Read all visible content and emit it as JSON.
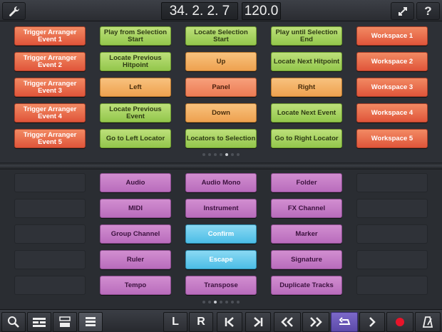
{
  "topbar": {
    "position": "34. 2. 2. 7",
    "tempo": "120.0",
    "icons": [
      "wrench-icon",
      "expand-icon",
      "help-icon"
    ],
    "help_label": "?"
  },
  "top_grid": {
    "columns": [
      {
        "pads": [
          {
            "label": "Trigger Arranger Event 1",
            "color": "orange"
          },
          {
            "label": "Trigger Arranger Event 2",
            "color": "orange"
          },
          {
            "label": "Trigger Arranger Event 3",
            "color": "orange"
          },
          {
            "label": "Trigger Arranger Event 4",
            "color": "orange"
          },
          {
            "label": "Trigger Arranger Event 5",
            "color": "orange"
          }
        ]
      },
      {
        "pads": [
          {
            "label": "Play from Selection Start",
            "color": "green"
          },
          {
            "label": "Locate Previous Hitpoint",
            "color": "green"
          },
          {
            "label": "Left",
            "color": "amber"
          },
          {
            "label": "Locate Previous Event",
            "color": "green"
          },
          {
            "label": "Go to Left Locator",
            "color": "green"
          }
        ]
      },
      {
        "pads": [
          {
            "label": "Locate Selection Start",
            "color": "green"
          },
          {
            "label": "Up",
            "color": "amber"
          },
          {
            "label": "Panel",
            "color": "salmon"
          },
          {
            "label": "Down",
            "color": "amber"
          },
          {
            "label": "Locators to Selection",
            "color": "green"
          }
        ]
      },
      {
        "pads": [
          {
            "label": "Play until Selection End",
            "color": "green"
          },
          {
            "label": "Locate Next Hitpoint",
            "color": "green"
          },
          {
            "label": "Right",
            "color": "amber"
          },
          {
            "label": "Locate Next Event",
            "color": "green"
          },
          {
            "label": "Go to Right Locator",
            "color": "green"
          }
        ]
      },
      {
        "pads": [
          {
            "label": "Workspace 1",
            "color": "orange"
          },
          {
            "label": "Workspace 2",
            "color": "orange"
          },
          {
            "label": "Workspace 3",
            "color": "orange"
          },
          {
            "label": "Workspace 4",
            "color": "orange"
          },
          {
            "label": "Workspace 5",
            "color": "orange"
          }
        ]
      }
    ],
    "page_count": 7,
    "active_page": 4
  },
  "bottom_grid": {
    "columns": [
      {
        "pads": [
          {
            "label": "",
            "color": "empty"
          },
          {
            "label": "",
            "color": "empty"
          },
          {
            "label": "",
            "color": "empty"
          },
          {
            "label": "",
            "color": "empty"
          },
          {
            "label": "",
            "color": "empty"
          }
        ]
      },
      {
        "pads": [
          {
            "label": "Audio",
            "color": "purple"
          },
          {
            "label": "MIDI",
            "color": "purple"
          },
          {
            "label": "Group Channel",
            "color": "purple"
          },
          {
            "label": "Ruler",
            "color": "purple"
          },
          {
            "label": "Tempo",
            "color": "purple"
          }
        ]
      },
      {
        "pads": [
          {
            "label": "Audio Mono",
            "color": "purple"
          },
          {
            "label": "Instrument",
            "color": "purple"
          },
          {
            "label": "Confirm",
            "color": "blue"
          },
          {
            "label": "Escape",
            "color": "blue"
          },
          {
            "label": "Transpose",
            "color": "purple"
          }
        ]
      },
      {
        "pads": [
          {
            "label": "Folder",
            "color": "purple"
          },
          {
            "label": "FX Channel",
            "color": "purple"
          },
          {
            "label": "Marker",
            "color": "purple"
          },
          {
            "label": "Signature",
            "color": "purple"
          },
          {
            "label": "Duplicate Tracks",
            "color": "purple"
          }
        ]
      },
      {
        "pads": [
          {
            "label": "",
            "color": "empty"
          },
          {
            "label": "",
            "color": "empty"
          },
          {
            "label": "",
            "color": "empty"
          },
          {
            "label": "",
            "color": "empty"
          },
          {
            "label": "",
            "color": "empty"
          }
        ]
      }
    ],
    "page_count": 7,
    "active_page": 2
  },
  "bottombar": {
    "left_label": "L",
    "right_label": "R",
    "buttons": [
      "search-icon",
      "mixer-layout-icon",
      "arrange-layout-icon",
      "keypad-layout-icon",
      "left-locator-button",
      "right-locator-button",
      "go-to-start-icon",
      "go-to-end-icon",
      "rewind-icon",
      "fast-forward-icon",
      "cycle-icon",
      "play-icon",
      "record-icon",
      "metronome-icon"
    ]
  },
  "colors": {
    "record": "#e8142a",
    "cycle": "#6a57bb",
    "active_dot": "#c9ccd1"
  }
}
